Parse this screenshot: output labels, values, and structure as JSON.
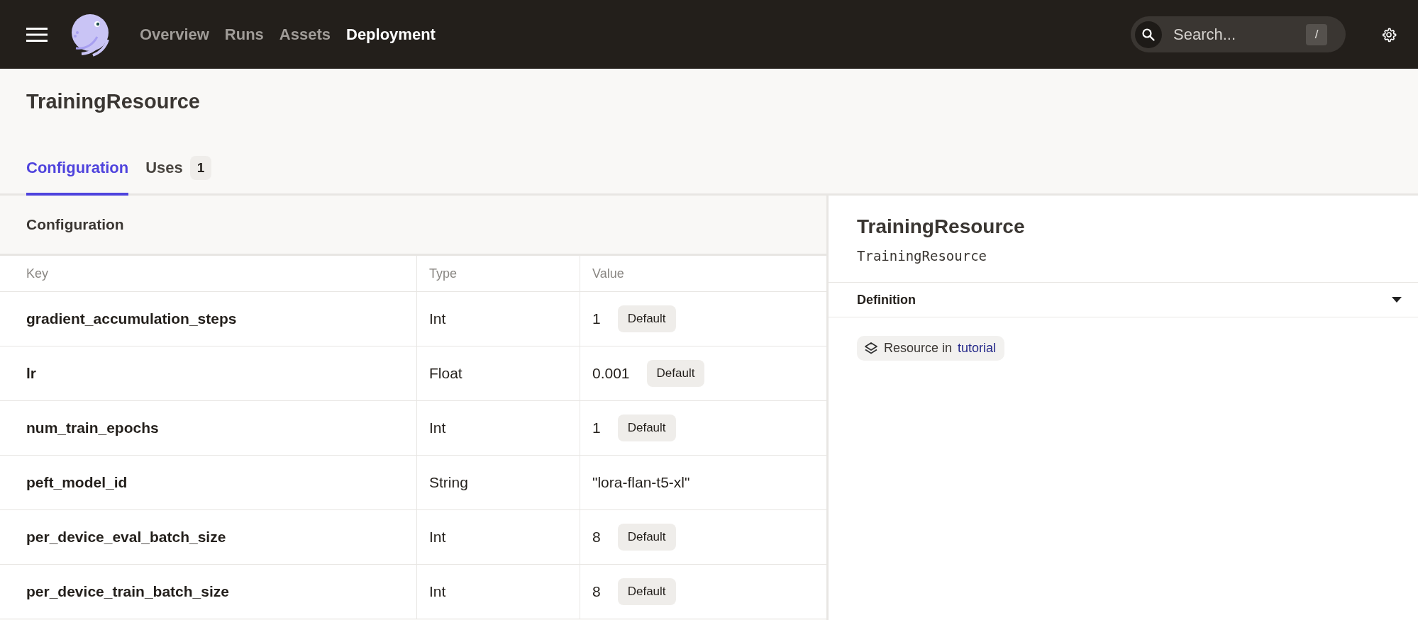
{
  "nav": {
    "items": [
      {
        "label": "Overview",
        "selected": false
      },
      {
        "label": "Runs",
        "selected": false
      },
      {
        "label": "Assets",
        "selected": false
      },
      {
        "label": "Deployment",
        "selected": true
      }
    ],
    "search": {
      "placeholder": "Search...",
      "shortcut": "/"
    }
  },
  "page": {
    "title": "TrainingResource"
  },
  "tabs": [
    {
      "label": "Configuration",
      "selected": true
    },
    {
      "label": "Uses",
      "selected": false,
      "count": "1"
    }
  ],
  "config": {
    "title": "Configuration",
    "columns": [
      "Key",
      "Type",
      "Value"
    ],
    "rows": [
      {
        "key": "gradient_accumulation_steps",
        "type": "Int",
        "value": "1",
        "tag": "Default"
      },
      {
        "key": "lr",
        "type": "Float",
        "value": "0.001",
        "tag": "Default"
      },
      {
        "key": "num_train_epochs",
        "type": "Int",
        "value": "1",
        "tag": "Default"
      },
      {
        "key": "peft_model_id",
        "type": "String",
        "value": "\"lora-flan-t5-xl\""
      },
      {
        "key": "per_device_eval_batch_size",
        "type": "Int",
        "value": "8",
        "tag": "Default"
      },
      {
        "key": "per_device_train_batch_size",
        "type": "Int",
        "value": "8",
        "tag": "Default"
      }
    ]
  },
  "details": {
    "title": "TrainingResource",
    "subtitle": "TrainingResource",
    "section": {
      "title": "Definition",
      "expanded": true,
      "badge": {
        "text": "Resource in",
        "link": "tutorial"
      }
    }
  }
}
